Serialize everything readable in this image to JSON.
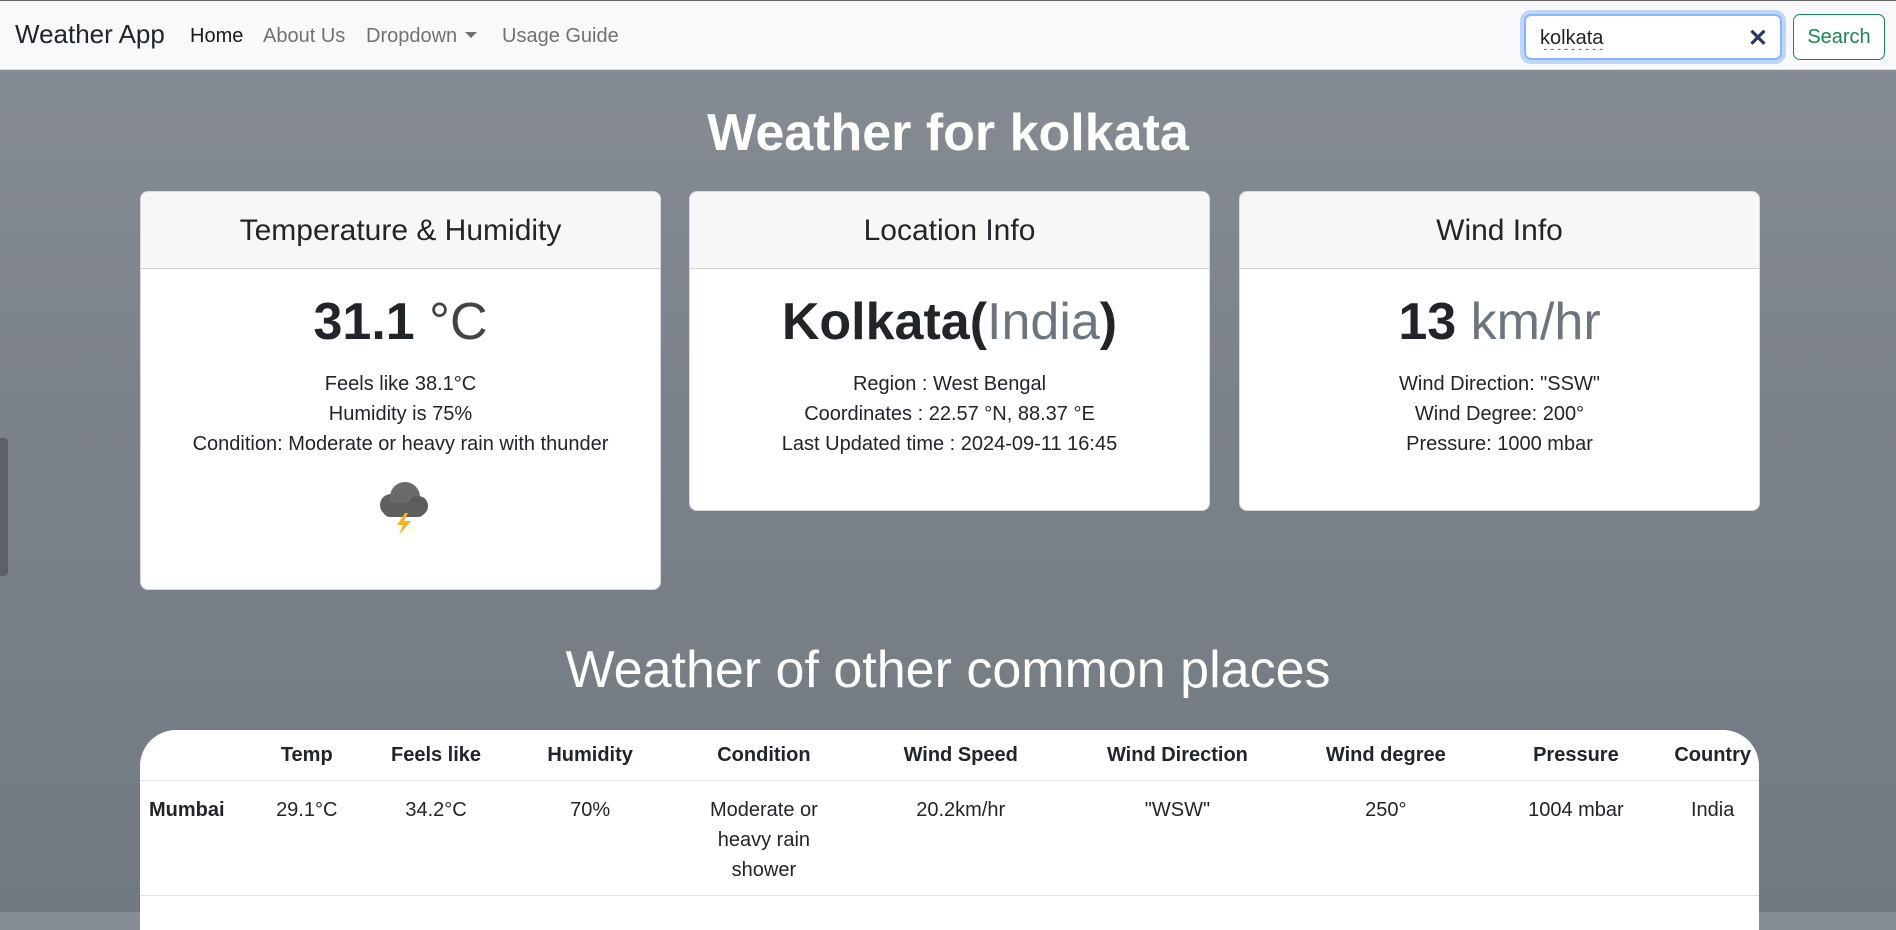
{
  "navbar": {
    "brand": "Weather App",
    "links": [
      {
        "label": "Home"
      },
      {
        "label": "About Us"
      },
      {
        "label": "Dropdown"
      },
      {
        "label": "Usage Guide"
      }
    ],
    "search": {
      "value": "kolkata",
      "button": "Search"
    }
  },
  "main": {
    "title": "Weather for kolkata",
    "temperature_card": {
      "header": "Temperature & Humidity",
      "temp": "31.1",
      "unit": "°C",
      "feels_like": "Feels like 38.1°C",
      "humidity": "Humidity is 75%",
      "condition": "Condition: Moderate or heavy rain with thunder",
      "icon": "thunderstorm-cloud-icon"
    },
    "location_card": {
      "header": "Location Info",
      "city": "Kolkata",
      "country": "India",
      "region": "Region : West Bengal",
      "coordinates": "Coordinates : 22.57 °N, 88.37 °E",
      "updated": "Last Updated time : 2024-09-11 16:45"
    },
    "wind_card": {
      "header": "Wind Info",
      "speed": "13",
      "unit": "km/hr",
      "direction": "Wind Direction: \"SSW\"",
      "degree": "Wind Degree: 200°",
      "pressure": "Pressure: 1000 mbar"
    }
  },
  "other_places": {
    "title": "Weather of other common places",
    "columns": [
      "",
      "Temp",
      "Feels like",
      "Humidity",
      "Condition",
      "Wind Speed",
      "Wind Direction",
      "Wind degree",
      "Pressure",
      "Country"
    ],
    "rows": [
      [
        "Mumbai",
        "29.1°C",
        "34.2°C",
        "70%",
        "Moderate or heavy rain shower",
        "20.2km/hr",
        "\"WSW\"",
        "250°",
        "1004 mbar",
        "India"
      ]
    ]
  },
  "colors": {
    "accent_success": "#198754",
    "focus_border": "#86b7fe",
    "background": "#7d838a"
  }
}
